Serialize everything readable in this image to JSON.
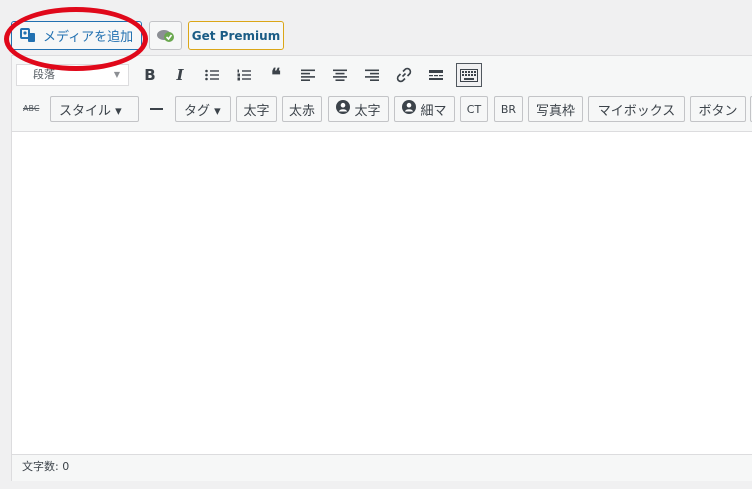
{
  "media_button": {
    "label": "メディアを追加"
  },
  "premium_button": {
    "label": "Get Premium"
  },
  "format_select": {
    "value": "段落"
  },
  "toolbar_row1": {
    "icons": [
      "bold-icon",
      "italic-icon",
      "bullet-list-icon",
      "numbered-list-icon",
      "blockquote-icon",
      "align-left-icon",
      "align-center-icon",
      "align-right-icon",
      "link-icon",
      "read-more-icon",
      "toolbar-toggle-icon"
    ],
    "bold_label": "B",
    "italic_label": "I"
  },
  "toolbar_row2": {
    "strike_label": "ABC",
    "style_dropdown": "スタイル ▾",
    "tag_dropdown": "タグ ▾",
    "buttons": [
      "太字",
      "太赤",
      "太字",
      "細マ",
      "CT",
      "BR",
      "写真枠",
      "マイボックス",
      "ボタン"
    ]
  },
  "status_bar": {
    "word_count": "文字数: 0"
  },
  "colors": {
    "accent": "#2271b1",
    "highlight_circle": "#e0081a"
  }
}
